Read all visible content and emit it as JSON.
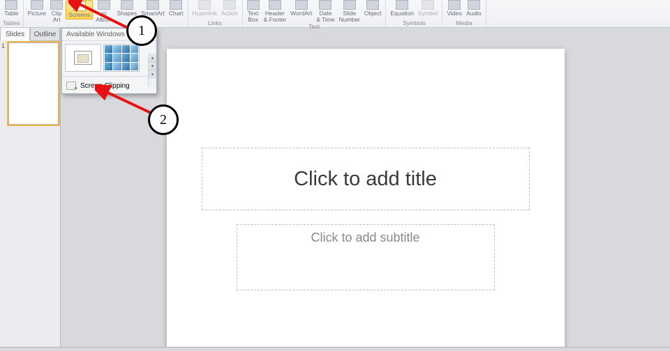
{
  "ribbon": {
    "groups": [
      {
        "label": "Tables",
        "items": [
          {
            "label": "Table"
          }
        ]
      },
      {
        "label": "",
        "items": [
          {
            "label": "Picture"
          },
          {
            "label": "Clip\nArt"
          },
          {
            "label": "Screens",
            "active": true
          },
          {
            "label": "to\nAlbum"
          },
          {
            "label": "Shapes"
          },
          {
            "label": "SmartArt"
          },
          {
            "label": "Chart"
          }
        ]
      },
      {
        "label": "Links",
        "items": [
          {
            "label": "Hyperlink",
            "disabled": true
          },
          {
            "label": "Action",
            "disabled": true
          }
        ]
      },
      {
        "label": "Text",
        "items": [
          {
            "label": "Text\nBox"
          },
          {
            "label": "Header\n& Footer"
          },
          {
            "label": "WordArt"
          },
          {
            "label": "Date\n& Time"
          },
          {
            "label": "Slide\nNumber"
          },
          {
            "label": "Object"
          }
        ]
      },
      {
        "label": "Symbols",
        "items": [
          {
            "label": "Equation"
          },
          {
            "label": "Symbol",
            "disabled": true
          }
        ]
      },
      {
        "label": "Media",
        "items": [
          {
            "label": "Video"
          },
          {
            "label": "Audio"
          }
        ]
      }
    ]
  },
  "sidebar": {
    "tabs": [
      {
        "label": "Slides",
        "active": true
      },
      {
        "label": "Outline"
      }
    ],
    "thumbs": [
      {
        "num": "1"
      }
    ]
  },
  "dropdown": {
    "header": "Available Windows",
    "clip": "Screen Clipping"
  },
  "slide": {
    "title_placeholder": "Click to add title",
    "subtitle_placeholder": "Click to add subtitle"
  },
  "annotations": {
    "n1": "1",
    "n2": "2"
  }
}
